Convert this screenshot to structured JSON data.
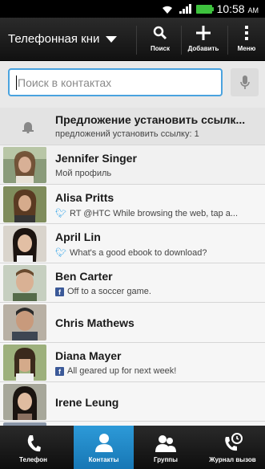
{
  "status_bar": {
    "time": "10:58",
    "ampm": "AM",
    "battery_color": "#3ec23e"
  },
  "action_bar": {
    "title": "Телефонная кни",
    "search_label": "Поиск",
    "add_label": "Добавить",
    "menu_label": "Меню"
  },
  "search": {
    "placeholder": "Поиск в контактах"
  },
  "list": {
    "notice": {
      "title": "Предложение установить ссылк...",
      "subtitle": "предложений установить ссылку: 1",
      "icon": "bell-icon"
    },
    "contacts": [
      {
        "name": "Jennifer Singer",
        "status": "Мой профиль",
        "source": ""
      },
      {
        "name": "Alisa Pritts",
        "status": "RT @HTC While browsing the web, tap a...",
        "source": "twitter"
      },
      {
        "name": "April Lin",
        "status": "What's a good ebook to download?",
        "source": "twitter"
      },
      {
        "name": "Ben Carter",
        "status": "Off to a soccer game.",
        "source": "facebook"
      },
      {
        "name": "Chris Mathews",
        "status": "",
        "source": ""
      },
      {
        "name": "Diana Mayer",
        "status": "All geared up for next week!",
        "source": "facebook"
      },
      {
        "name": "Irene Leung",
        "status": "",
        "source": ""
      }
    ]
  },
  "tabs": [
    {
      "label": "Телефон",
      "icon": "phone-icon",
      "active": false
    },
    {
      "label": "Контакты",
      "icon": "person-icon",
      "active": true
    },
    {
      "label": "Группы",
      "icon": "group-icon",
      "active": false
    },
    {
      "label": "Журнал вызов",
      "icon": "call-history-icon",
      "active": false
    }
  ],
  "colors": {
    "accent": "#2d9ad8",
    "twitter": "#2fa3e8",
    "facebook": "#3b5998"
  }
}
